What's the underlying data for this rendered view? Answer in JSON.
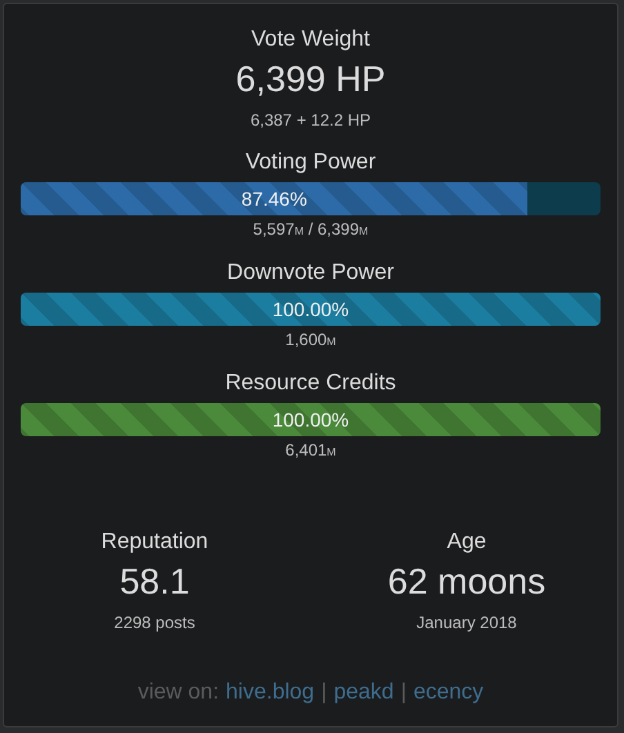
{
  "vote_weight": {
    "title": "Vote Weight",
    "value": "6,399 HP",
    "detail": "6,387 + 12.2 HP"
  },
  "meters": [
    {
      "title": "Voting Power",
      "reading": "87.46%",
      "level": 0.8746,
      "color": "#2c6ba8",
      "label_parts": [
        {
          "text": "5,597",
          "unit": "M"
        },
        {
          "text": " / "
        },
        {
          "text": "6,399",
          "unit": "M"
        }
      ]
    },
    {
      "title": "Downvote Power",
      "reading": "100.00%",
      "level": 1,
      "color": "#1b7ea0",
      "label_parts": [
        {
          "text": "1,600",
          "unit": "M"
        }
      ]
    },
    {
      "title": "Resource Credits",
      "reading": "100.00%",
      "level": 1,
      "color": "#4a8a3a",
      "label_parts": [
        {
          "text": "6,401",
          "unit": "M"
        }
      ]
    }
  ],
  "stats": [
    {
      "title": "Reputation",
      "value": "58.1",
      "detail": "2298 posts"
    },
    {
      "title": "Age",
      "value": "62 moons",
      "detail": "January 2018"
    }
  ],
  "footer": {
    "prefix": "view on:",
    "separator": "|",
    "links": [
      "hive.blog",
      "peakd",
      "ecency"
    ]
  }
}
